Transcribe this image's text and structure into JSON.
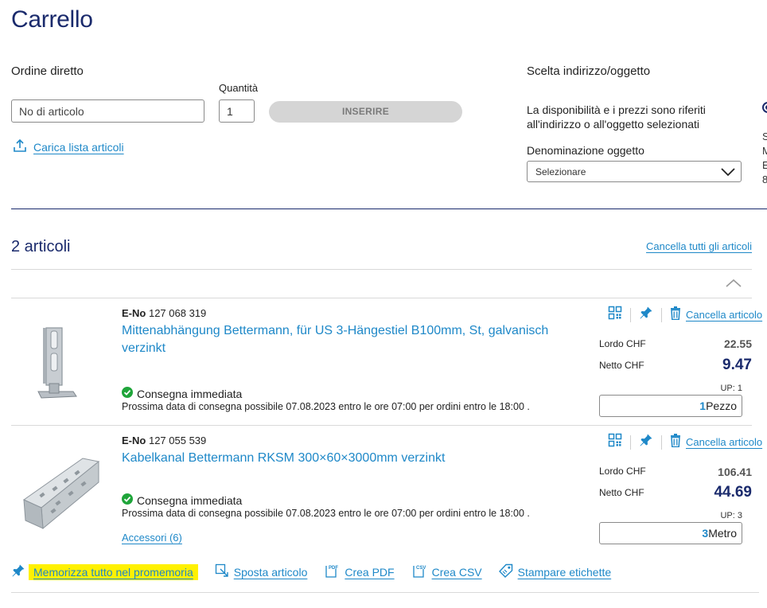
{
  "page": {
    "title": "Carrello"
  },
  "direct_order": {
    "label": "Ordine diretto",
    "article_placeholder": "No di articolo",
    "quantity_label": "Quantità",
    "quantity_value": "1",
    "insert_button": "INSERIRE",
    "upload_link": "Carica lista articoli"
  },
  "address": {
    "label": "Scelta indirizzo/oggetto",
    "info_line1": "La disponibilità e i prezzi sono riferiti",
    "info_line2": "all'indirizzo o all'oggetto selezionati",
    "object_label": "Denominazione oggetto",
    "select_value": "Selezionare",
    "cut_text": [
      "S",
      "M",
      "E",
      "8"
    ]
  },
  "cart": {
    "count_label": "2 articoli",
    "clear_all": "Cancella tutti gli articoli",
    "items": [
      {
        "eno_label": "E-No",
        "eno": "127 068 319",
        "title_line1": "Mittenabhängung Bettermann, für US 3-Hängestiel B100mm, St, galvanisch",
        "title_line2": "verzinkt",
        "delivery": "Consegna immediata",
        "delivery_sub": "Prossima data di consegna possibile 07.08.2023 entro le ore 07:00 per ordini entro le 18:00 .",
        "cancel": "Cancella articolo",
        "lordo_label": "Lordo CHF",
        "lordo": "22.55",
        "netto_label": "Netto CHF",
        "netto": "9.47",
        "up": "UP: 1",
        "qty": "1",
        "unit": "Pezzo"
      },
      {
        "eno_label": "E-No",
        "eno": "127 055 539",
        "title_line1": "Kabelkanal Bettermann RKSM 300×60×3000mm verzinkt",
        "delivery": "Consegna immediata",
        "delivery_sub": "Prossima data di consegna possibile 07.08.2023 entro le ore 07:00 per ordini entro le 18:00 .",
        "accessories": "Accessori (6)",
        "cancel": "Cancella articolo",
        "lordo_label": "Lordo CHF",
        "lordo": "106.41",
        "netto_label": "Netto CHF",
        "netto": "44.69",
        "up": "UP: 3",
        "qty": "3",
        "unit": "Metro"
      }
    ]
  },
  "bottom_actions": {
    "memorize": "Memorizza tutto nel promemoria",
    "move": "Sposta articolo",
    "pdf": "Crea PDF",
    "csv": "Crea CSV",
    "labels": "Stampare etichette",
    "pdf_badge": "PDF",
    "csv_badge": "CSV"
  },
  "colors": {
    "brand_navy": "#1a2a6c",
    "link_blue": "#1e88c8",
    "success_green": "#1fa53a",
    "highlight": "#fff100"
  }
}
